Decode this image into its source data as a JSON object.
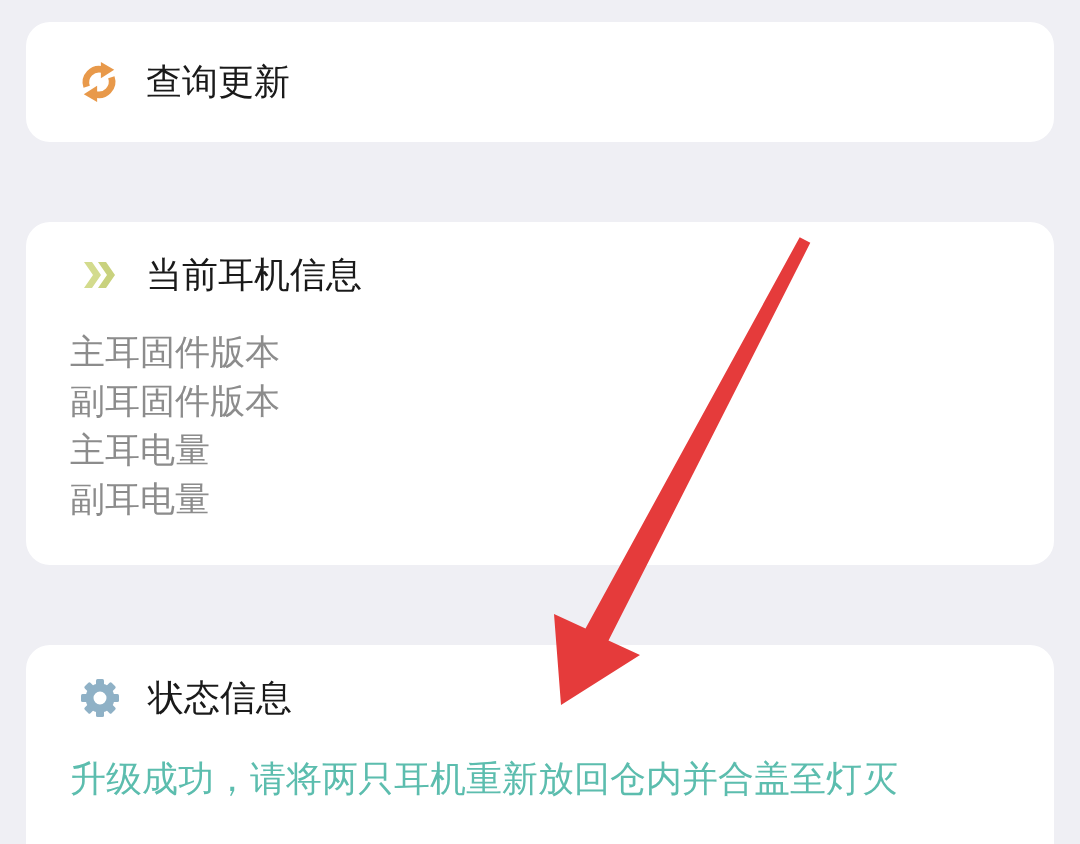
{
  "sections": [
    {
      "kind": "update",
      "title": "查询更新"
    },
    {
      "kind": "info",
      "title": "当前耳机信息",
      "lines": [
        "主耳固件版本",
        "副耳固件版本",
        "主耳电量",
        "副耳电量"
      ]
    },
    {
      "kind": "status",
      "title": "状态信息",
      "message": "升级成功，请将两只耳机重新放回仓内并合盖至灯灭"
    }
  ],
  "annotations": [
    {
      "kind": "arrow"
    }
  ]
}
